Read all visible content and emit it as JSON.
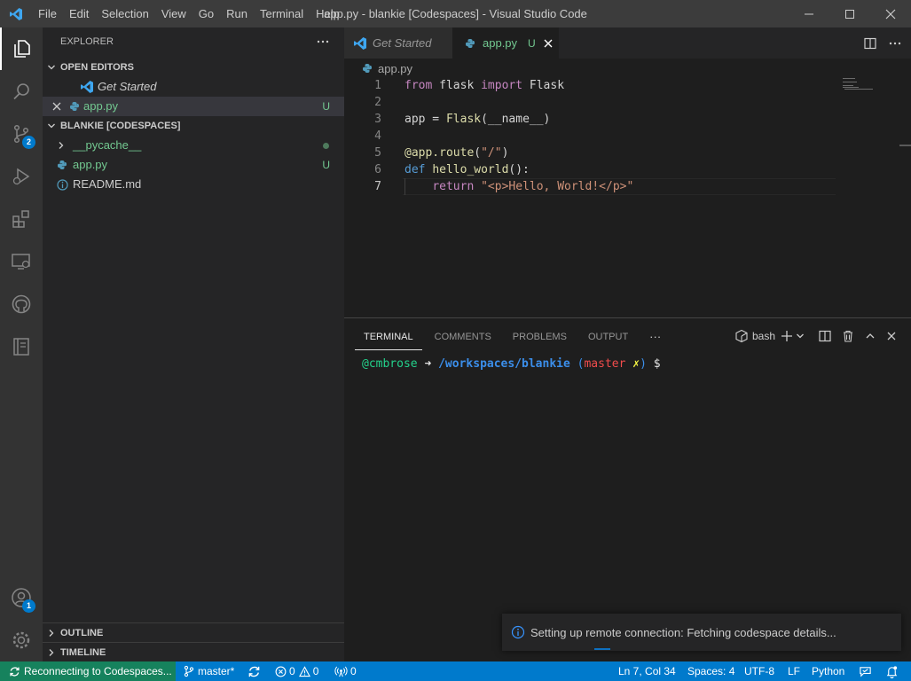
{
  "window": {
    "title": "app.py - blankie [Codespaces] - Visual Studio Code"
  },
  "menu": [
    "File",
    "Edit",
    "Selection",
    "View",
    "Go",
    "Run",
    "Terminal",
    "Help"
  ],
  "activity": {
    "scm_badge": "2",
    "accounts_badge": "1"
  },
  "explorer": {
    "title": "EXPLORER",
    "open_editors": {
      "header": "OPEN EDITORS",
      "items": [
        {
          "label": "Get Started"
        },
        {
          "label": "app.py",
          "status": "U"
        }
      ]
    },
    "workspace": {
      "header": "BLANKIE [CODESPACES]",
      "items": [
        {
          "label": "__pycache__"
        },
        {
          "label": "app.py",
          "status": "U"
        },
        {
          "label": "README.md"
        }
      ]
    },
    "outline": "OUTLINE",
    "timeline": "TIMELINE"
  },
  "tabs": [
    {
      "label": "Get Started"
    },
    {
      "label": "app.py",
      "status": "U"
    }
  ],
  "breadcrumb": "app.py",
  "code": {
    "line_numbers": [
      "1",
      "2",
      "3",
      "4",
      "5",
      "6",
      "7"
    ]
  },
  "panel": {
    "tabs": [
      "TERMINAL",
      "COMMENTS",
      "PROBLEMS",
      "OUTPUT"
    ],
    "more": "···",
    "shell": "bash",
    "prompt": {
      "user": "@cmbrose",
      "arrow": " ➜ ",
      "path": "/workspaces/blankie",
      "branch_open": " (",
      "branch": "master",
      "dirty": " ✗",
      "branch_close": ")",
      "dollar": " $"
    }
  },
  "notification": {
    "text": "Setting up remote connection: Fetching codespace details..."
  },
  "statusbar": {
    "remote": "Reconnecting to Codespaces...",
    "branch": "master*",
    "errors": "0",
    "warnings": "0",
    "ports": "0",
    "position": "Ln 7, Col 34",
    "spaces": "Spaces: 4",
    "encoding": "UTF-8",
    "eol": "LF",
    "language": "Python"
  }
}
